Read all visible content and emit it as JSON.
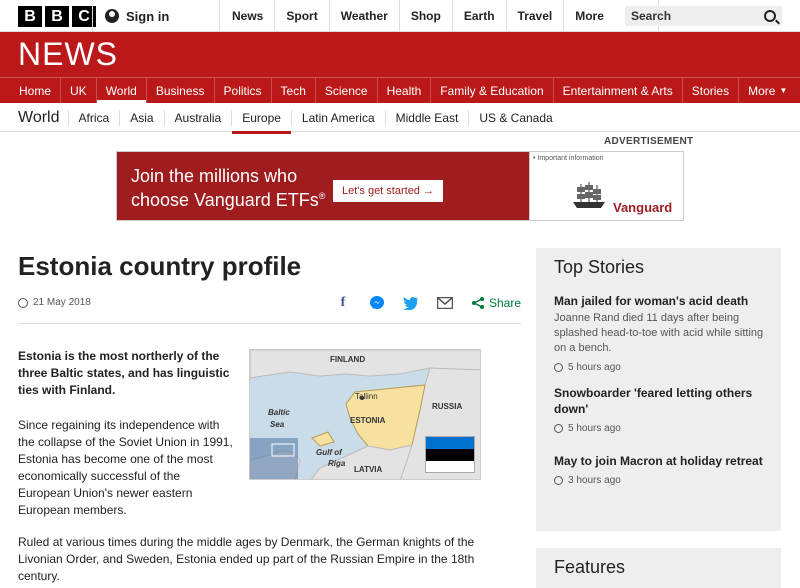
{
  "bbc_logo": [
    "B",
    "B",
    "C"
  ],
  "top": {
    "signin": "Sign in",
    "nav": [
      "News",
      "Sport",
      "Weather",
      "Shop",
      "Earth",
      "Travel"
    ],
    "more": "More",
    "search_placeholder": "Search"
  },
  "news_logo": "NEWS",
  "main_nav": {
    "items": [
      "Home",
      "UK",
      "World",
      "Business",
      "Politics",
      "Tech",
      "Science",
      "Health",
      "Family & Education",
      "Entertainment & Arts",
      "Stories"
    ],
    "more": "More"
  },
  "sub_nav": {
    "section": "World",
    "items": [
      "Africa",
      "Asia",
      "Australia",
      "Europe",
      "Latin America",
      "Middle East",
      "US & Canada"
    ]
  },
  "ad": {
    "label": "ADVERTISEMENT",
    "line1": "Join the millions who",
    "line2": "choose Vanguard ETFs",
    "reg": "®",
    "cta": "Let's get started →",
    "important": "• Important information",
    "brand": "Vanguard"
  },
  "article": {
    "title": "Estonia country profile",
    "date": "21 May 2018",
    "share": "Share",
    "lead": "Estonia is the most northerly of the three Baltic states, and has linguistic ties with Finland.",
    "p1": "Since regaining its independence with the collapse of the Soviet Union in 1991, Estonia has become one of the most economically successful of the European Union's newer eastern European members.",
    "p2": "Ruled at various times during the middle ages by Denmark, the German knights of the Livonian Order, and Sweden, Estonia ended up part of the Russian Empire in the 18th century."
  },
  "map": {
    "finland": "FINLAND",
    "tallinn": "Tallinn",
    "russia": "RUSSIA",
    "estonia": "ESTONIA",
    "baltic": "Baltic",
    "sea": "Sea",
    "gulf": "Gulf of",
    "riga": "Riga",
    "latvia": "LATVIA"
  },
  "sidebar": {
    "title": "Top Stories",
    "stories": [
      {
        "title": "Man jailed for woman's acid death",
        "summary": "Joanne Rand died 11 days after being splashed head-to-toe with acid while sitting on a bench.",
        "time": "5 hours ago"
      },
      {
        "title": "Snowboarder 'feared letting others down'",
        "summary": "",
        "time": "5 hours ago"
      },
      {
        "title": "May to join Macron at holiday retreat",
        "summary": "",
        "time": "3 hours ago"
      }
    ]
  },
  "features_title": "Features",
  "colors": {
    "bbc_red": "#bb1919",
    "vanguard_red": "#9f1c1f",
    "estonia_blue": "#0072ce"
  }
}
